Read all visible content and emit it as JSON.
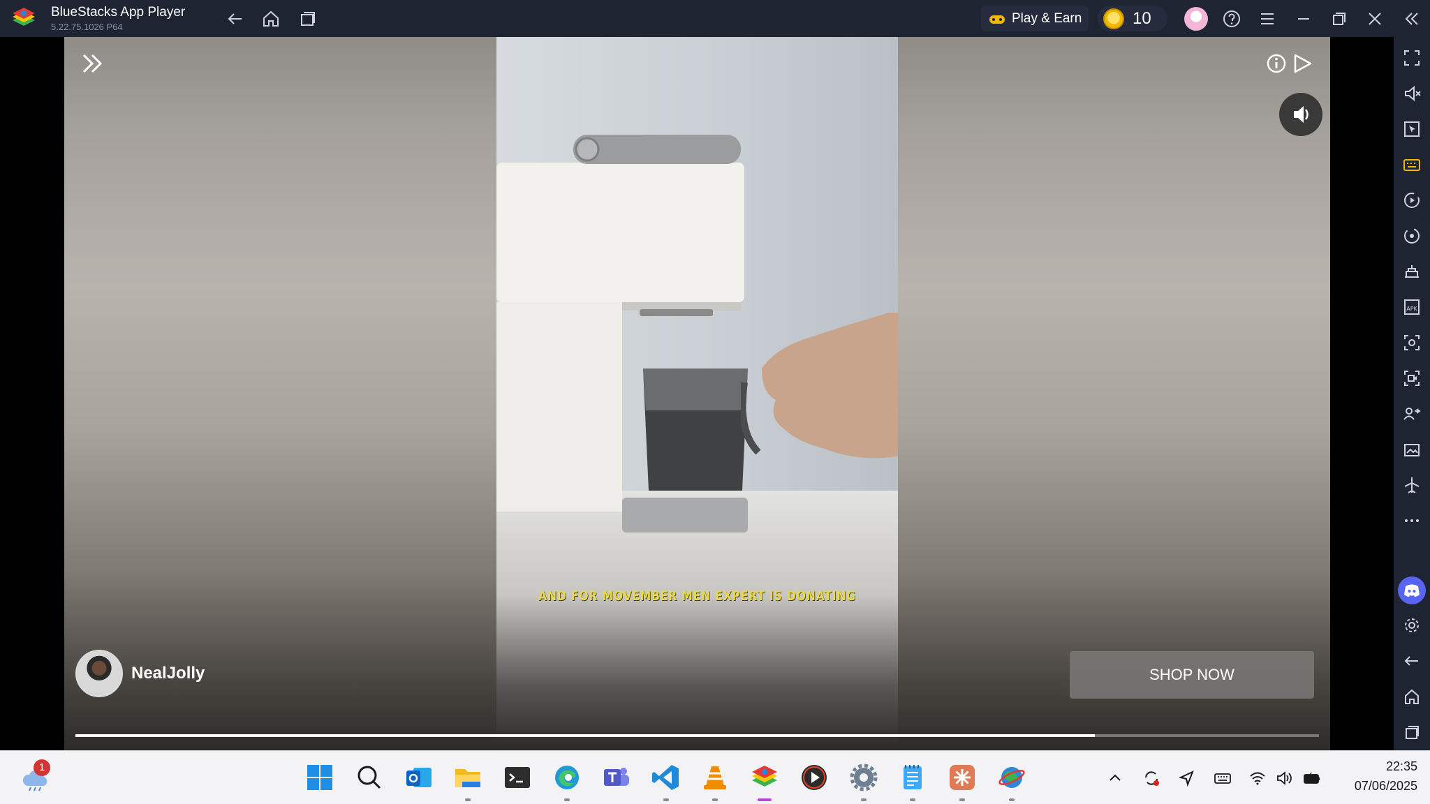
{
  "window": {
    "title": "BlueStacks App Player",
    "version": "5.22.75.1026  P64",
    "play_earn_label": "Play & Earn",
    "coin_count": "10"
  },
  "ad": {
    "subtitle": "AND FOR MOVEMBER MEN EXPERT IS DONATING",
    "creator_name": "NealJolly",
    "cta_label": "SHOP NOW",
    "progress": 0.82
  },
  "taskbar": {
    "weather_badge": "1",
    "time": "22:35",
    "date": "07/06/2025"
  },
  "colors": {
    "titlebar_bg": "#1f2433",
    "subtitle": "#e8d84a",
    "active_indicator": "#b44bd6",
    "discord": "#5865f2"
  }
}
